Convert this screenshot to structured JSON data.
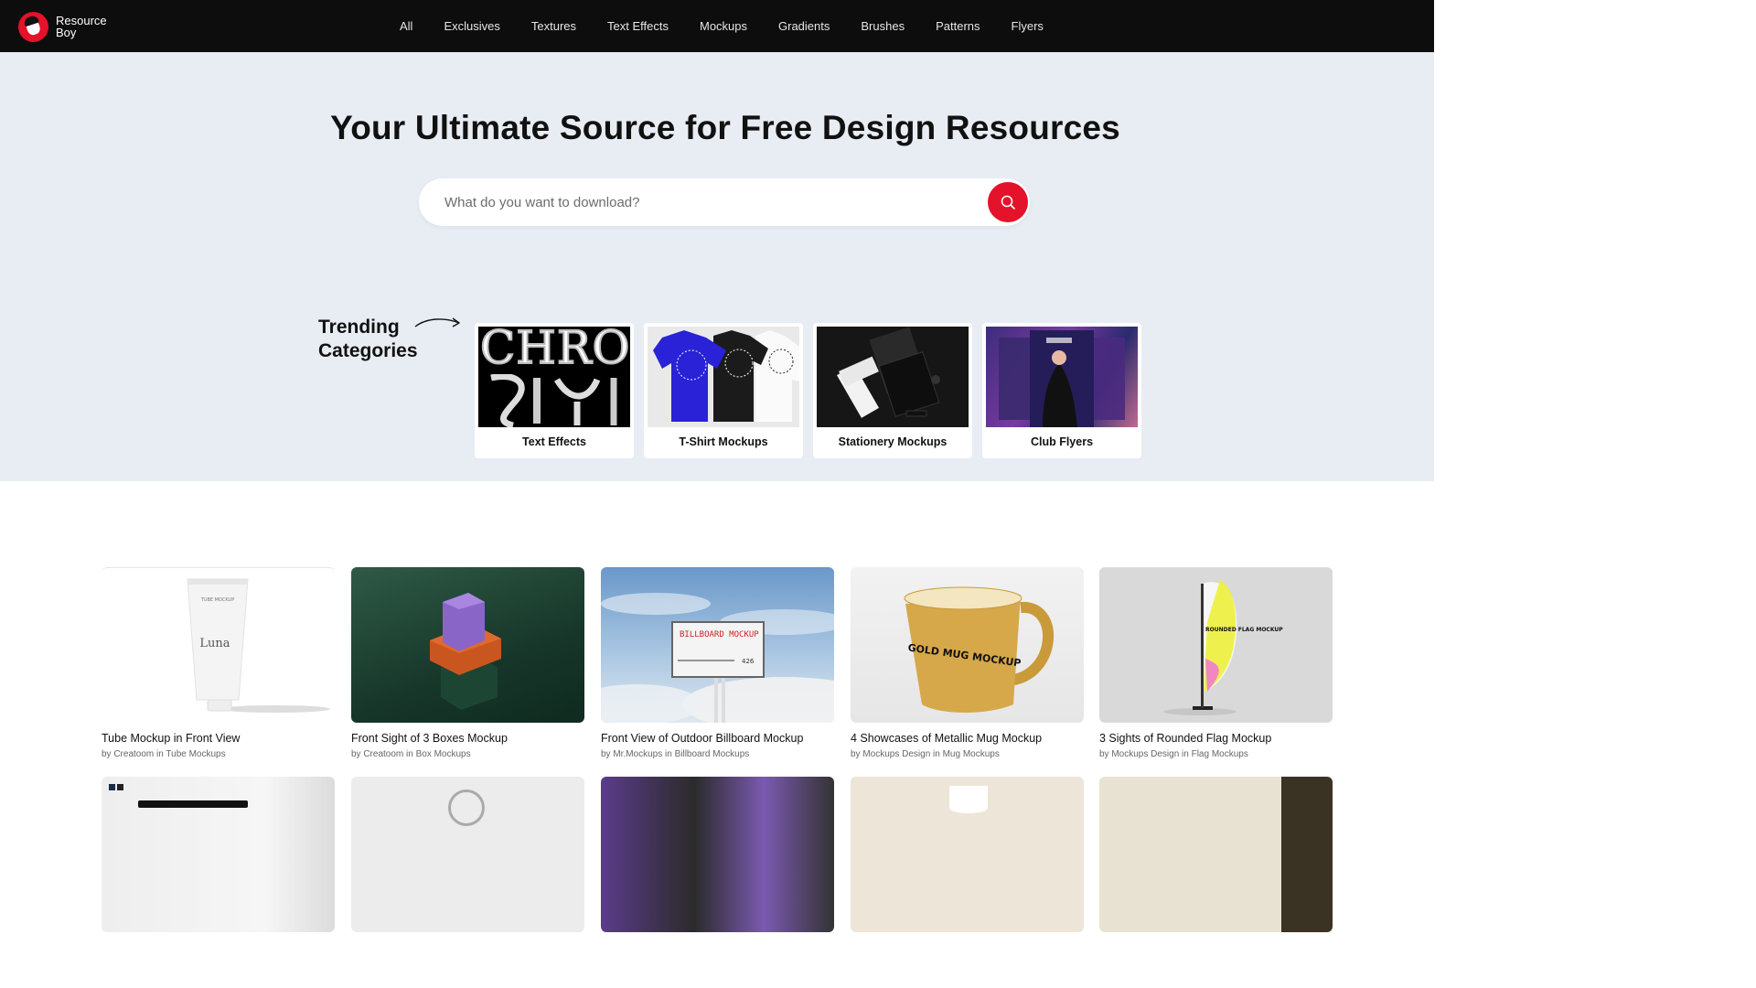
{
  "brand": {
    "name_line1": "Resource",
    "name_line2": "Boy",
    "accent": "#e4122a"
  },
  "nav": {
    "items": [
      "All",
      "Exclusives",
      "Textures",
      "Text Effects",
      "Mockups",
      "Gradients",
      "Brushes",
      "Patterns",
      "Flyers"
    ]
  },
  "hero": {
    "title": "Your Ultimate Source for Free Design Resources",
    "search_placeholder": "What do you want to download?",
    "trending_line1": "Trending",
    "trending_line2": "Categories",
    "categories": [
      {
        "label": "Text Effects"
      },
      {
        "label": "T-Shirt Mockups"
      },
      {
        "label": "Stationery Mockups"
      },
      {
        "label": "Club Flyers"
      }
    ]
  },
  "grid": {
    "items": [
      {
        "title": "Tube Mockup in Front View",
        "meta": "by Creatoom in Tube Mockups"
      },
      {
        "title": "Front Sight of 3 Boxes Mockup",
        "meta": "by Creatoom in Box Mockups"
      },
      {
        "title": "Front View of Outdoor Billboard Mockup",
        "meta": "by Mr.Mockups in Billboard Mockups"
      },
      {
        "title": "4 Showcases of Metallic Mug Mockup",
        "meta": "by Mockups Design in Mug Mockups"
      },
      {
        "title": "3 Sights of Rounded Flag Mockup",
        "meta": "by Mockups Design in Flag Mockups"
      }
    ]
  },
  "thumb_text": {
    "text_effect": "CHRO",
    "tube_top": "TUBE MOCKUP",
    "tube_brand": "Luna",
    "billboard": "BILLBOARD MOCKUP",
    "billboard_num": "426",
    "mug": "GOLD MUG MOCKUP",
    "flag": "ROUNDED FLAG MOCKUP"
  }
}
